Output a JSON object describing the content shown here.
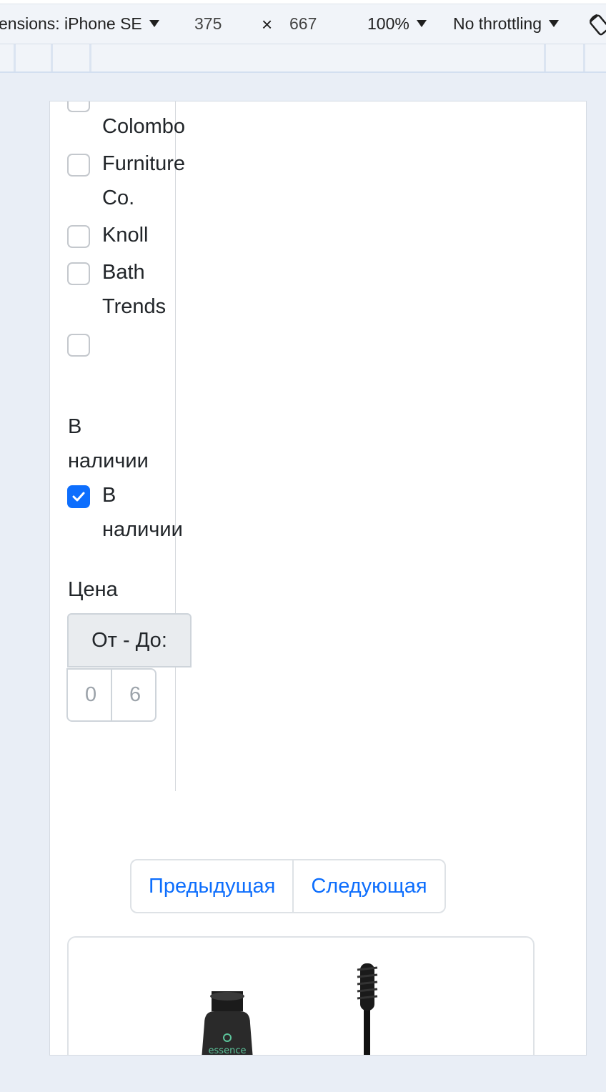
{
  "devtools": {
    "dimensions_label": "ensions: iPhone SE",
    "width": "375",
    "times": "×",
    "height": "667",
    "zoom": "100%",
    "throttling": "No throttling"
  },
  "filters": {
    "brands": [
      {
        "label": "Colombo",
        "checked": false
      },
      {
        "label": "Furniture",
        "label2": "Co.",
        "checked": false
      },
      {
        "label": "Knoll",
        "checked": false
      },
      {
        "label": "Bath",
        "label2": "Trends",
        "checked": false
      },
      {
        "label": "",
        "checked": false
      }
    ],
    "availability": {
      "heading_line1": "В",
      "heading_line2": "наличии",
      "option_line1": "В",
      "option_line2": "наличии",
      "checked": true
    },
    "price": {
      "heading": "Цена",
      "range_label": "От - До:",
      "min_value": "0",
      "max_value": "6"
    }
  },
  "pagination": {
    "prev": "Предыдущая",
    "next": "Следующая"
  },
  "product": {
    "brand_text": "essence"
  },
  "colors": {
    "accent": "#0d6efd",
    "page_bg": "#e9eef6"
  }
}
